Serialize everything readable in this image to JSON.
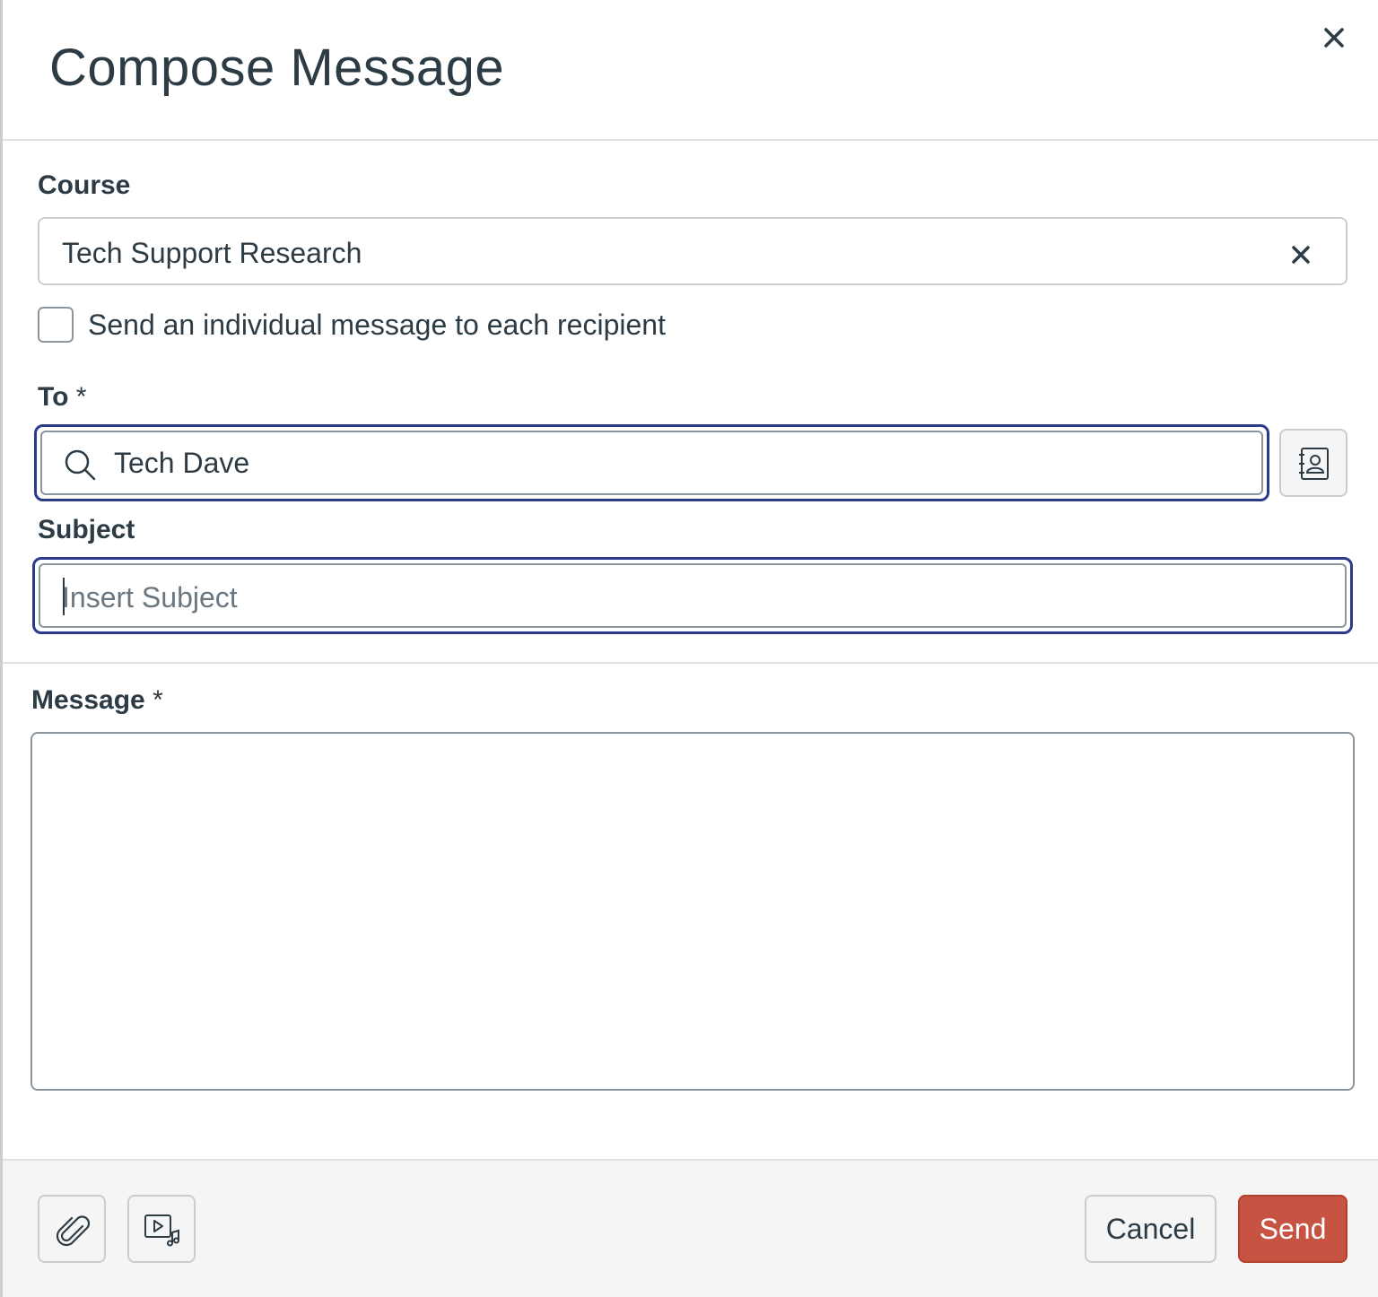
{
  "dialog": {
    "title": "Compose Message"
  },
  "course": {
    "label": "Course",
    "value": "Tech Support Research"
  },
  "individual_message": {
    "label": "Send an individual message to each recipient",
    "checked": false
  },
  "to": {
    "label": "To",
    "required_marker": "*",
    "value": "Tech Dave"
  },
  "subject": {
    "label": "Subject",
    "placeholder": "Insert Subject",
    "value": ""
  },
  "message": {
    "label": "Message",
    "required_marker": "*",
    "value": ""
  },
  "footer": {
    "cancel_label": "Cancel",
    "send_label": "Send"
  },
  "icons": {
    "close": "close-icon",
    "course_clear": "clear-icon",
    "search": "search-icon",
    "address_book": "address-book-icon",
    "attach": "paperclip-icon",
    "media": "media-icon"
  },
  "colors": {
    "focus_ring": "#2b3a8c",
    "send_button": "#c75443",
    "text": "#2d3b45",
    "footer_bg": "#f5f5f5"
  }
}
